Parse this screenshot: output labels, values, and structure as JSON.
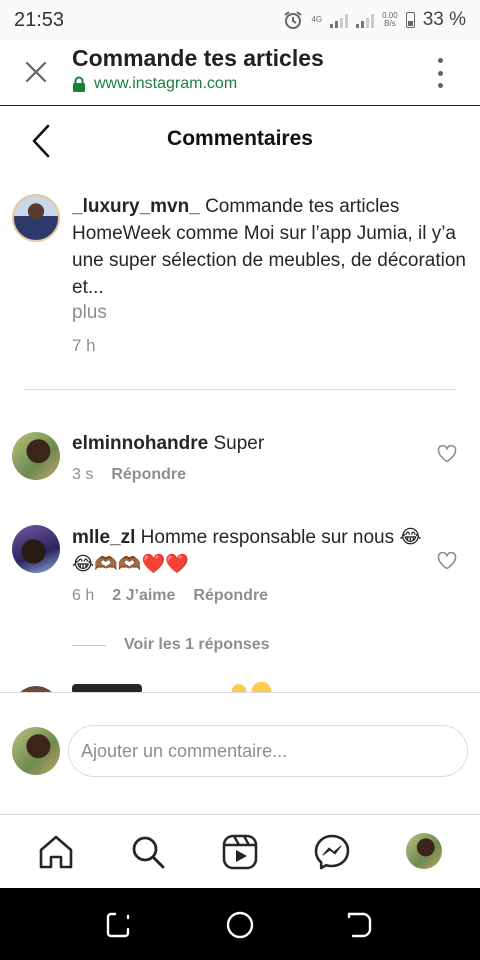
{
  "status": {
    "time": "21:53",
    "network": "4G",
    "speed_value": "0.00",
    "speed_unit": "B/s",
    "battery": "33 %"
  },
  "browser": {
    "title": "Commande tes articles",
    "url": "www.instagram.com"
  },
  "page": {
    "title": "Commentaires"
  },
  "caption": {
    "username": "_luxury_mvn_",
    "text": " Commande tes articles HomeWeek comme Moi sur l’app Jumia, il y’a une super sélection de meubles, de décoration et...",
    "more": "plus",
    "time": "7 h"
  },
  "comments": [
    {
      "username": "elminnohandre",
      "text": " Super",
      "time": "3 s",
      "likes": "",
      "reply": "Répondre"
    },
    {
      "username": "mlle_zl",
      "text": " Homme responsable sur nous 😂😂🫶🏾🫶🏾❤️❤️",
      "time": "6 h",
      "likes": "2 J’aime",
      "reply": "Répondre"
    }
  ],
  "replies_toggle": "Voir les 1 réponses",
  "composer": {
    "placeholder": "Ajouter un commentaire..."
  },
  "colors": {
    "url_green": "#1b7f3a",
    "secondary_text": "#8e8e8e",
    "heart_red": "#e0245e"
  }
}
